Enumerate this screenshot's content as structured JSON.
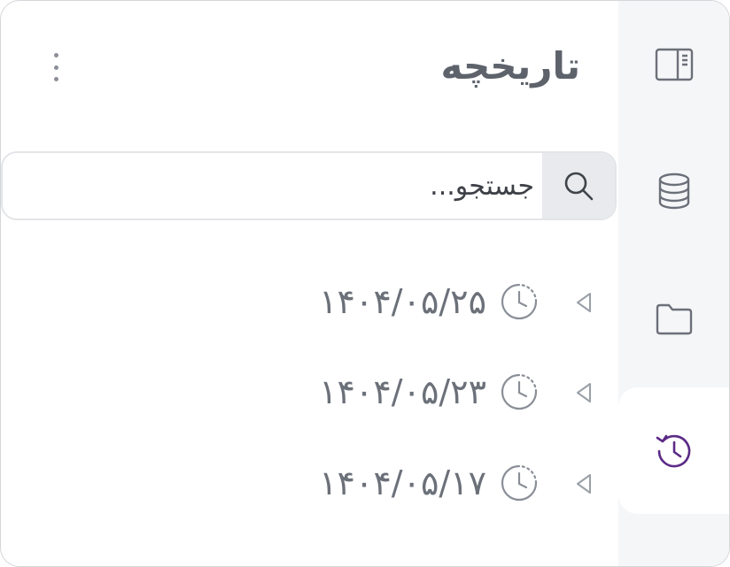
{
  "panel": {
    "title": "تاریخچه"
  },
  "search": {
    "placeholder": "جستجو..."
  },
  "history": {
    "items": [
      {
        "date": "۱۴۰۴/۰۵/۲۵"
      },
      {
        "date": "۱۴۰۴/۰۵/۲۳"
      },
      {
        "date": "۱۴۰۴/۰۵/۱۷"
      }
    ]
  },
  "rail": {
    "buttons": [
      {
        "icon": "panel-toggle-icon"
      },
      {
        "icon": "database-icon"
      },
      {
        "icon": "folder-icon"
      },
      {
        "icon": "history-icon",
        "active": true
      }
    ]
  },
  "colors": {
    "accent": "#5b2a86",
    "title": "#5d626b",
    "rail_bg": "#f5f6f8",
    "search_button_bg": "#e8eaed"
  }
}
